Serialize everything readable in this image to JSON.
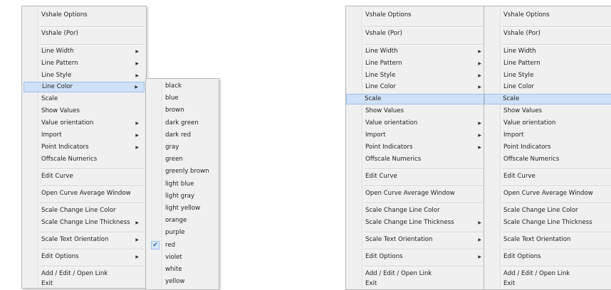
{
  "menu": {
    "options_label": "Vshale Options",
    "por_label": "Vshale (Por)",
    "line_width": "Line Width",
    "line_pattern": "Line Pattern",
    "line_style": "Line Style",
    "line_color": "Line Color",
    "scale": "Scale",
    "show_values": "Show Values",
    "value_orientation": "Value orientation",
    "import": "Import",
    "point_indicators": "Point Indicators",
    "offscale_numerics": "Offscale Numerics",
    "edit_curve": "Edit Curve",
    "open_curve_average": "Open Curve Average Window",
    "scale_change_line_color": "Scale Change Line Color",
    "scale_change_line_thickness": "Scale Change Line Thickness",
    "scale_text_orientation": "Scale Text Orientation",
    "edit_options": "Edit Options",
    "add_edit_open_link": "Add / Edit / Open Link",
    "exit": "Exit"
  },
  "submenu_arrow": "▶",
  "checkmark": "✔",
  "colors": [
    "black",
    "blue",
    "brown",
    "dark green",
    "dark red",
    "gray",
    "green",
    "greenly brown",
    "light blue",
    "light gray",
    "light yellow",
    "orange",
    "purple",
    "red",
    "violet",
    "white",
    "yellow"
  ],
  "selected_color": "red",
  "highlight": {
    "left_menu": "Line Color",
    "right_menus": "Scale"
  }
}
